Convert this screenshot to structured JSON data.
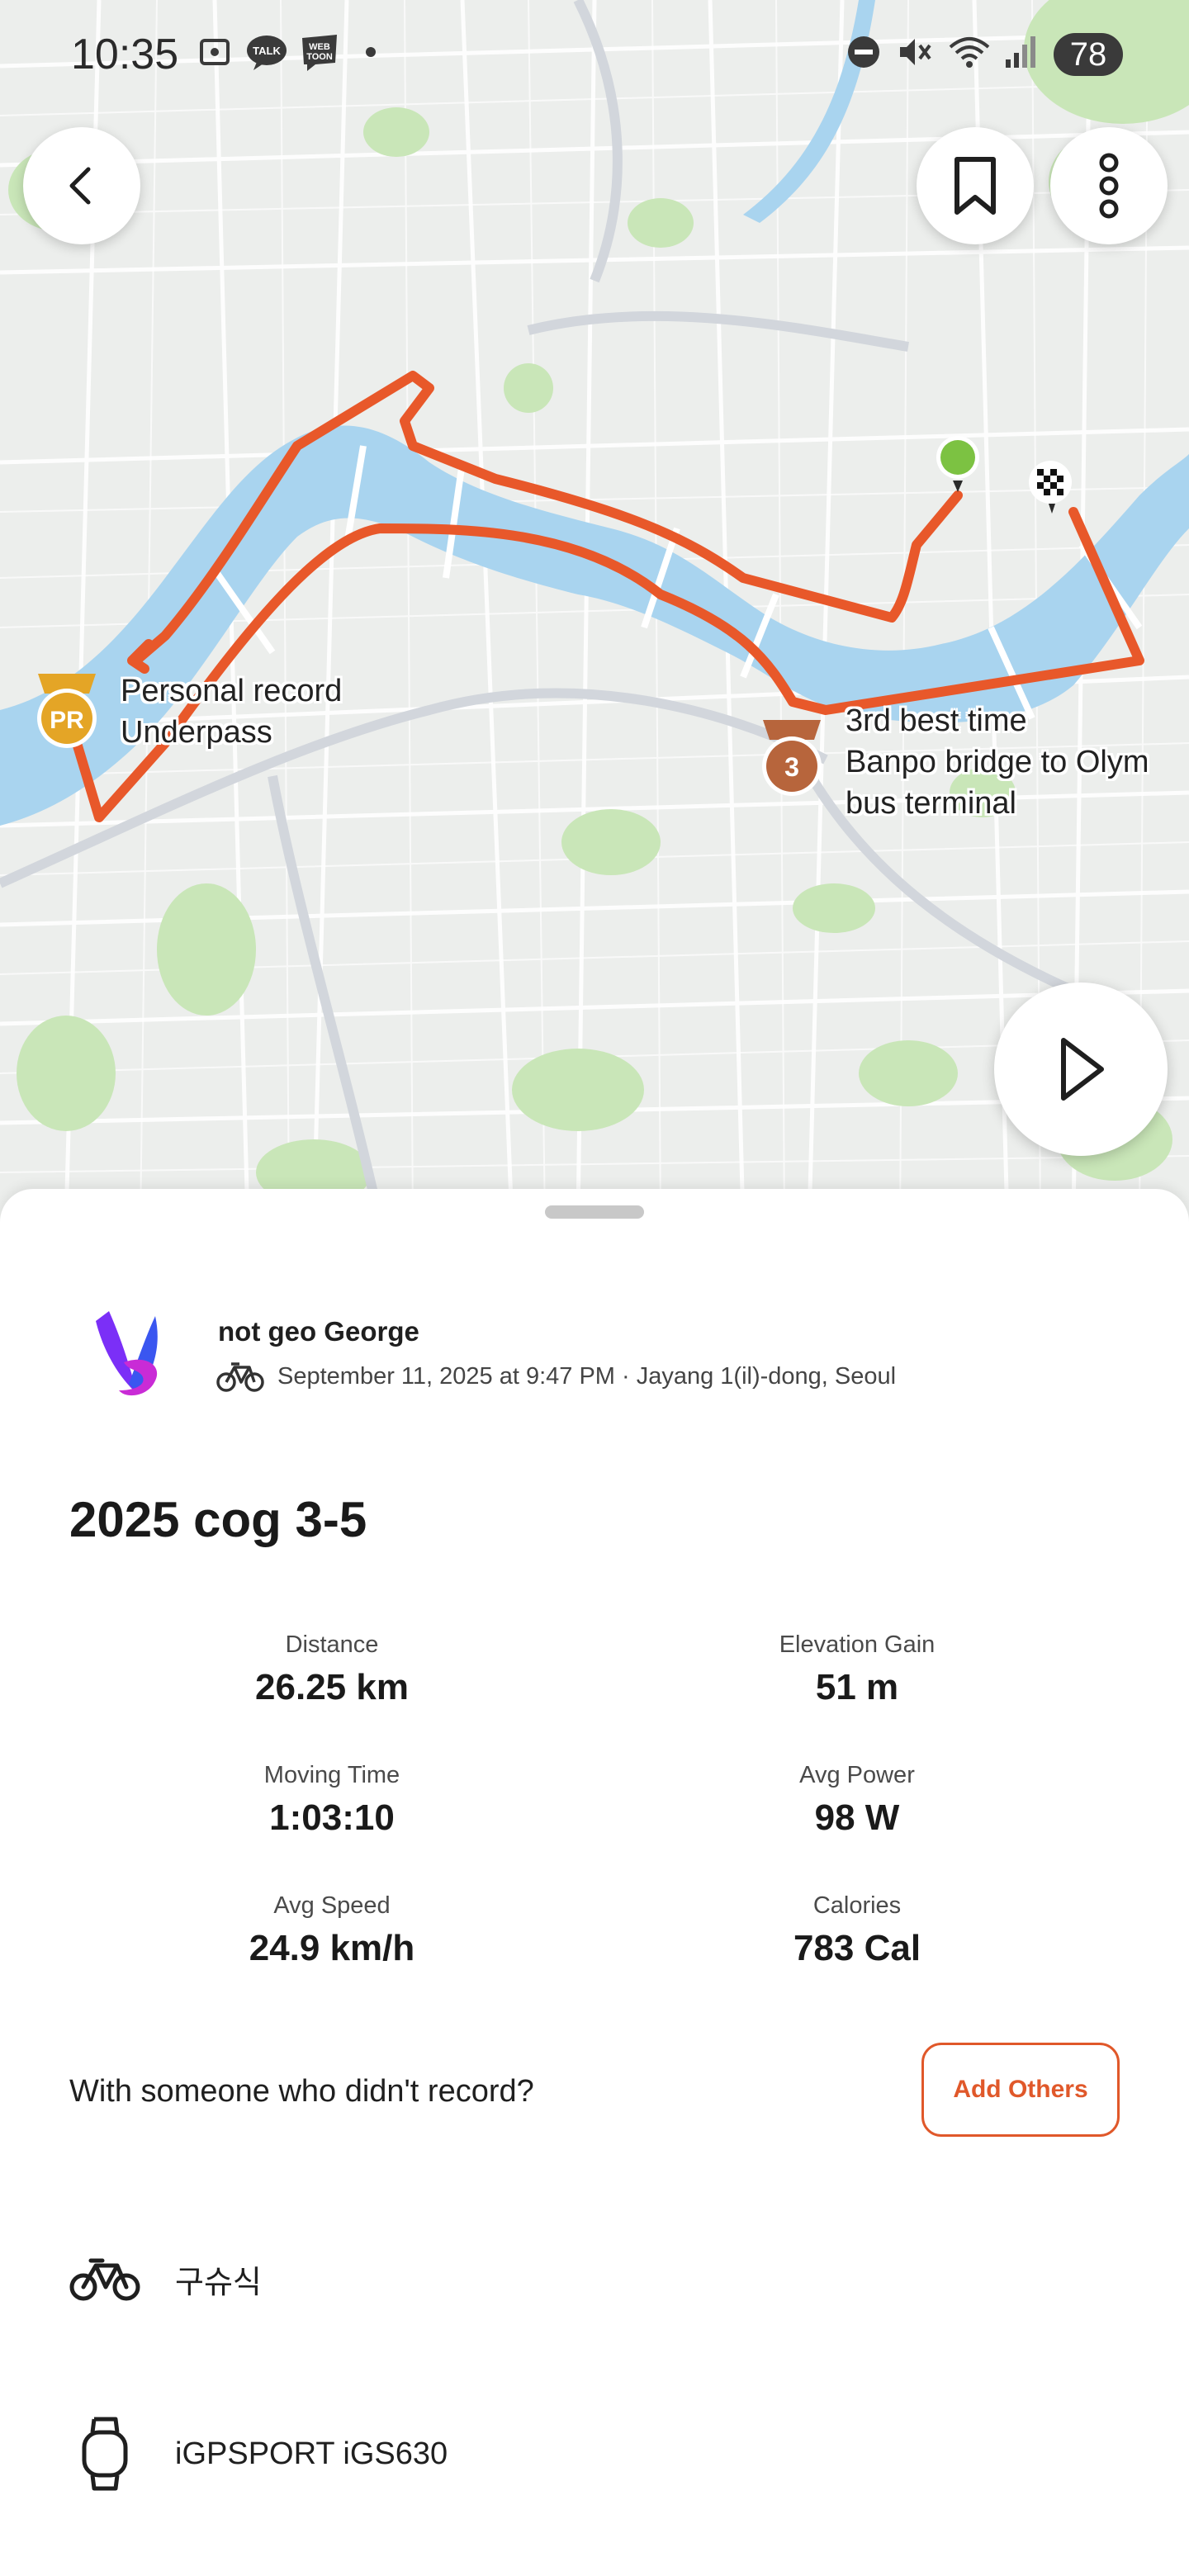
{
  "status_bar": {
    "time": "10:35",
    "icons": [
      "screenshot-icon",
      "talk-icon",
      "webtoon-icon",
      "dot-icon",
      "dnd-icon",
      "mute-icon",
      "wifi-icon",
      "signal-icon"
    ],
    "battery": "78"
  },
  "map": {
    "route_color": "#e8582a",
    "labels": {
      "pr_line1": "Personal record",
      "pr_line2": "Underpass",
      "third_line1": "3rd best time",
      "third_line2": "Banpo bridge to Olym",
      "third_line3": "bus terminal"
    },
    "badges": {
      "pr": "PR",
      "third": "3"
    }
  },
  "athlete": {
    "name": "not geo George",
    "meta": "September 11, 2025 at 9:47 PM · Jayang 1(il)-dong, Seoul"
  },
  "activity": {
    "title": "2025 cog 3-5",
    "stats": [
      {
        "label": "Distance",
        "value": "26.25 km"
      },
      {
        "label": "Elevation Gain",
        "value": "51 m"
      },
      {
        "label": "Moving Time",
        "value": "1:03:10"
      },
      {
        "label": "Avg Power",
        "value": "98 W"
      },
      {
        "label": "Avg Speed",
        "value": "24.9 km/h"
      },
      {
        "label": "Calories",
        "value": "783 Cal"
      }
    ]
  },
  "prompt": {
    "text": "With someone who didn't record?",
    "button": "Add Others"
  },
  "gear": {
    "bike": "구슈식",
    "device": "iGPSPORT iGS630"
  },
  "colors": {
    "accent": "#e0582a",
    "water": "#a9d4ef",
    "park": "#c9e6b8",
    "start": "#7cc242"
  }
}
